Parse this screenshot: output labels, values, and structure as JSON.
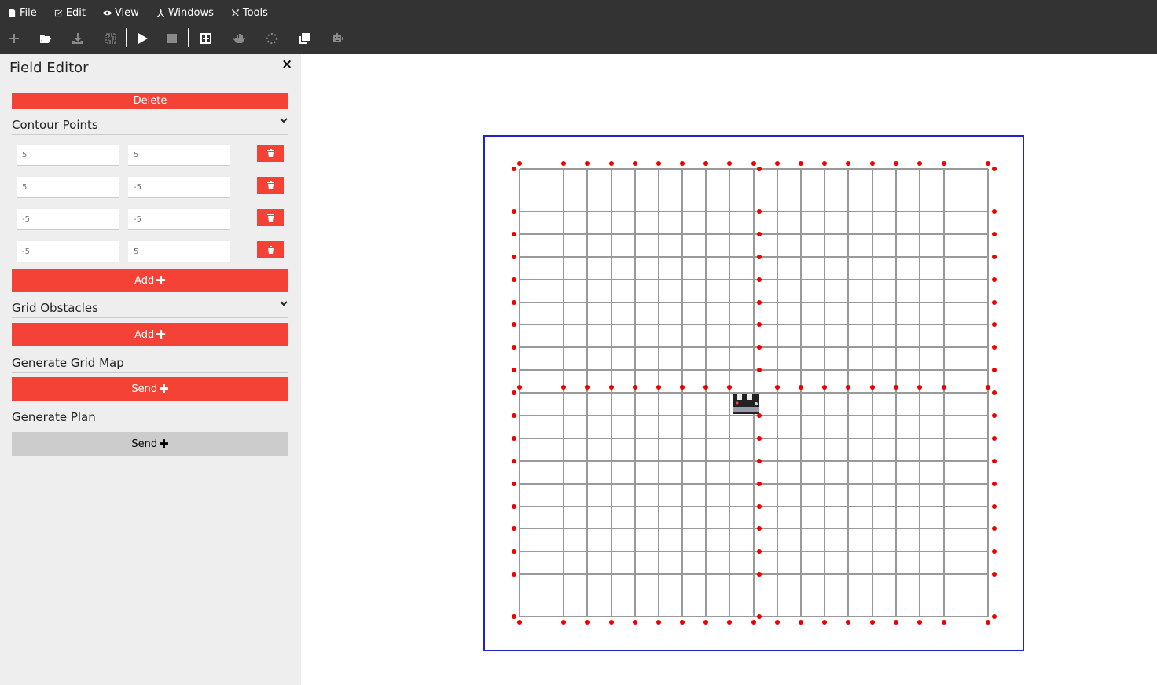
{
  "menu": {
    "items": [
      {
        "label": "File",
        "icon": "file-icon"
      },
      {
        "label": "Edit",
        "icon": "edit-icon"
      },
      {
        "label": "View",
        "icon": "eye-icon"
      },
      {
        "label": "Windows",
        "icon": "windows-icon"
      },
      {
        "label": "Tools",
        "icon": "tools-icon"
      }
    ]
  },
  "toolbar": {
    "tools": [
      {
        "name": "new",
        "icon": "plus-icon",
        "enabled": false
      },
      {
        "name": "open",
        "icon": "folder-open-icon",
        "enabled": true
      },
      {
        "name": "download",
        "icon": "download-icon",
        "enabled": false
      },
      {
        "name": "select",
        "icon": "select-area-icon",
        "enabled": false
      },
      {
        "name": "play",
        "icon": "play-icon",
        "enabled": true
      },
      {
        "name": "stop",
        "icon": "stop-icon",
        "enabled": false
      },
      {
        "name": "add-obstacle",
        "icon": "add-square-icon",
        "enabled": true
      },
      {
        "name": "pan",
        "icon": "hand-icon",
        "enabled": false
      },
      {
        "name": "loading",
        "icon": "spinner-icon",
        "enabled": false
      },
      {
        "name": "copy",
        "icon": "copy-icon",
        "enabled": true
      },
      {
        "name": "robot",
        "icon": "robot-icon",
        "enabled": false
      }
    ]
  },
  "panel": {
    "title": "Field Editor",
    "close": "×",
    "delete_label": "Delete",
    "contour_points": {
      "title": "Contour Points",
      "points": [
        {
          "x": "5",
          "y": "5"
        },
        {
          "x": "5",
          "y": "-5"
        },
        {
          "x": "-5",
          "y": "-5"
        },
        {
          "x": "-5",
          "y": "5"
        }
      ],
      "add_label": "Add"
    },
    "grid_obstacles": {
      "title": "Grid Obstacles",
      "add_label": "Add"
    },
    "generate_grid_map": {
      "title": "Generate Grid Map",
      "send_label": "Send"
    },
    "generate_plan": {
      "title": "Generate Plan",
      "send_label": "Send"
    }
  },
  "colors": {
    "accent": "#f44336",
    "boundary": "#2222cc",
    "grid_line": "#999999",
    "point": "#ee0000",
    "topbar": "#333333",
    "panel_bg": "#eeeeee"
  }
}
